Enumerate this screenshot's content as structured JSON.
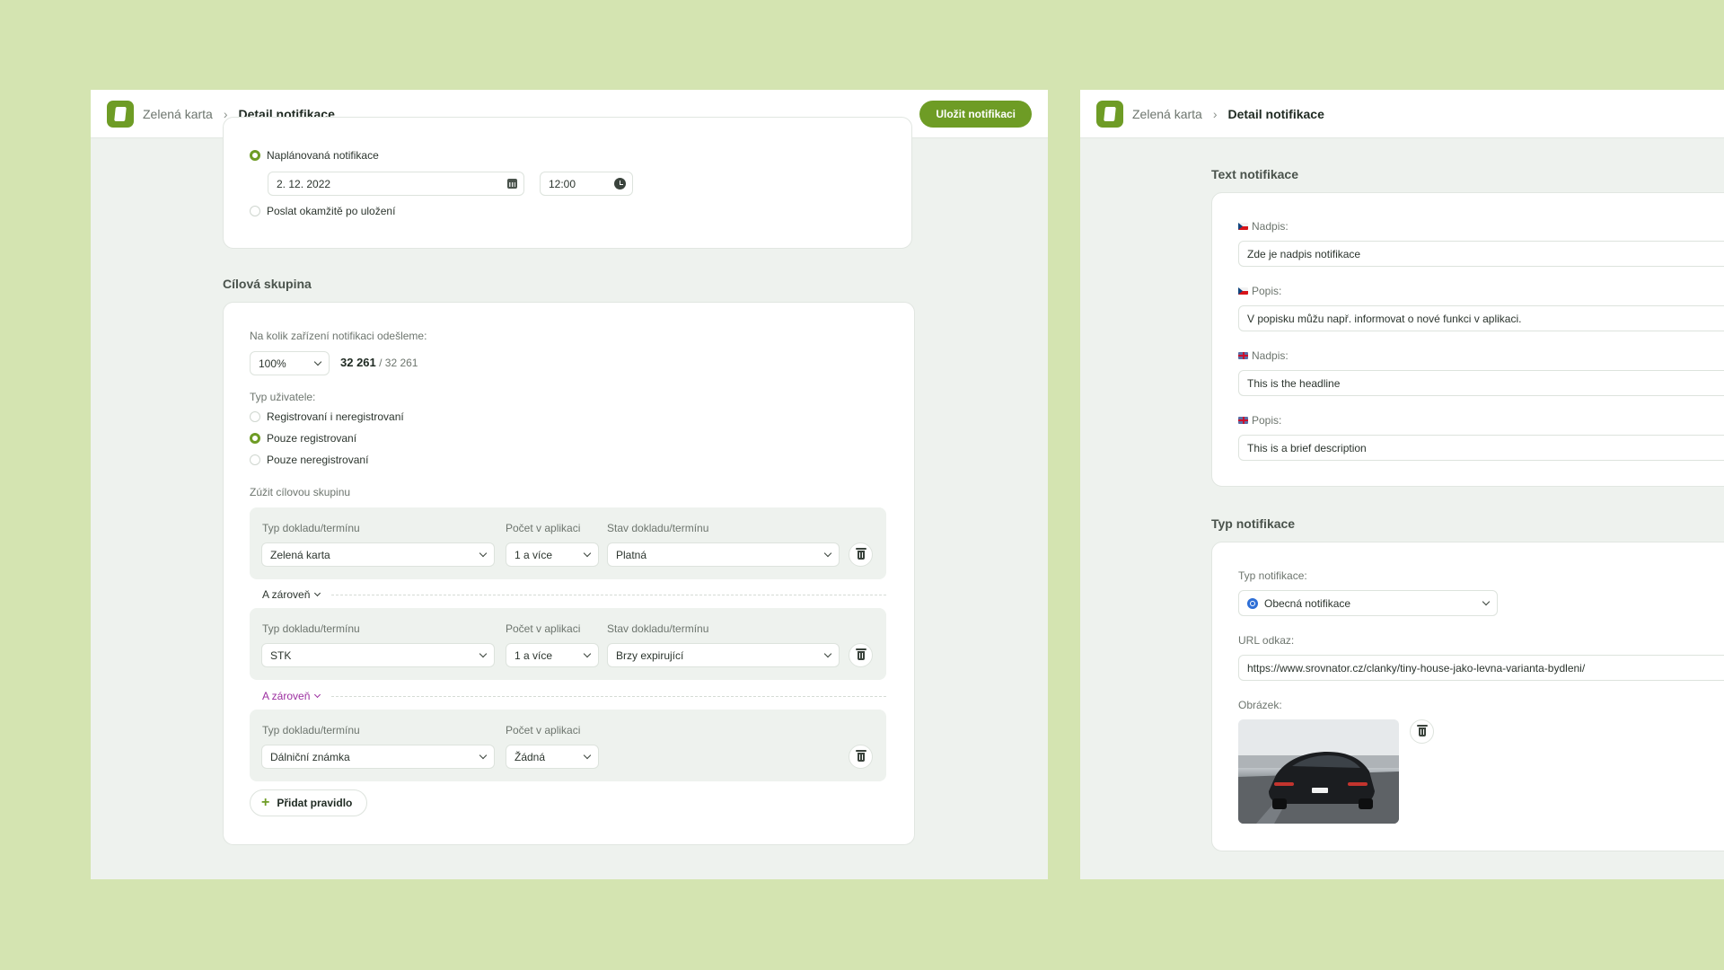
{
  "left": {
    "breadcrumb": {
      "app": "Zelená karta",
      "separator": "›",
      "current": "Detail notifikace"
    },
    "save_button": "Uložit notifikaci",
    "schedule": {
      "planned_label": "Naplánovaná notifikace",
      "date": "2. 12. 2022",
      "time": "12:00",
      "send_now_label": "Poslat okamžitě po uložení",
      "selected": "planned"
    },
    "target_group": {
      "title": "Cílová skupina",
      "devices_question": "Na kolik zařízení notifikaci odešleme:",
      "percent": "100%",
      "count": "32 261",
      "count_sep": " / ",
      "total": "32 261",
      "user_type_label": "Typ uživatele:",
      "user_types": [
        {
          "label": "Registrovaní i neregistrovaní",
          "selected": false
        },
        {
          "label": "Pouze registrovaní",
          "selected": true
        },
        {
          "label": "Pouze neregistrovaní",
          "selected": false
        }
      ],
      "narrow_label": "Zúžit cílovou skupinu",
      "rules": [
        {
          "type_header": "Typ dokladu/termínu",
          "count_header": "Počet v aplikaci",
          "state_header": "Stav dokladu/termínu",
          "type": "Zelená karta",
          "count": "1 a více",
          "state": "Platná"
        },
        {
          "type_header": "Typ dokladu/termínu",
          "count_header": "Počet v aplikaci",
          "state_header": "Stav dokladu/termínu",
          "type": "STK",
          "count": "1 a více",
          "state": "Brzy expirující"
        },
        {
          "type_header": "Typ dokladu/termínu",
          "count_header": "Počet v aplikaci",
          "type": "Dálniční známka",
          "count": "Žádná"
        }
      ],
      "and_labels": [
        "A zároveň",
        "A zároveň"
      ],
      "add_rule": "Přidat pravidlo"
    }
  },
  "right": {
    "breadcrumb": {
      "app": "Zelená karta",
      "separator": "›",
      "current": "Detail notifikace"
    },
    "text_section": {
      "title": "Text notifikace",
      "fields": [
        {
          "label": "Nadpis:",
          "lang": "cz",
          "value": "Zde je nadpis notifikace"
        },
        {
          "label": "Popis:",
          "lang": "cz",
          "value": "V popisku můžu např. informovat o nové funkci v aplikaci."
        },
        {
          "label": "Nadpis:",
          "lang": "en",
          "value": "This is the headline"
        },
        {
          "label": "Popis:",
          "lang": "en",
          "value": "This is a brief description"
        }
      ]
    },
    "type_section": {
      "title": "Typ notifikace",
      "type_label": "Typ notifikace:",
      "type_value": "Obecná notifikace",
      "url_label": "URL odkaz:",
      "url_value": "https://www.srovnator.cz/clanky/tiny-house-jako-levna-varianta-bydleni/",
      "image_label": "Obrázek:"
    }
  },
  "colors": {
    "accent": "#6e9c25",
    "background": "#d4e4b1",
    "panel": "#eef2ee",
    "link_purple": "#9c2fa0",
    "type_icon": "#2e6fd6"
  }
}
